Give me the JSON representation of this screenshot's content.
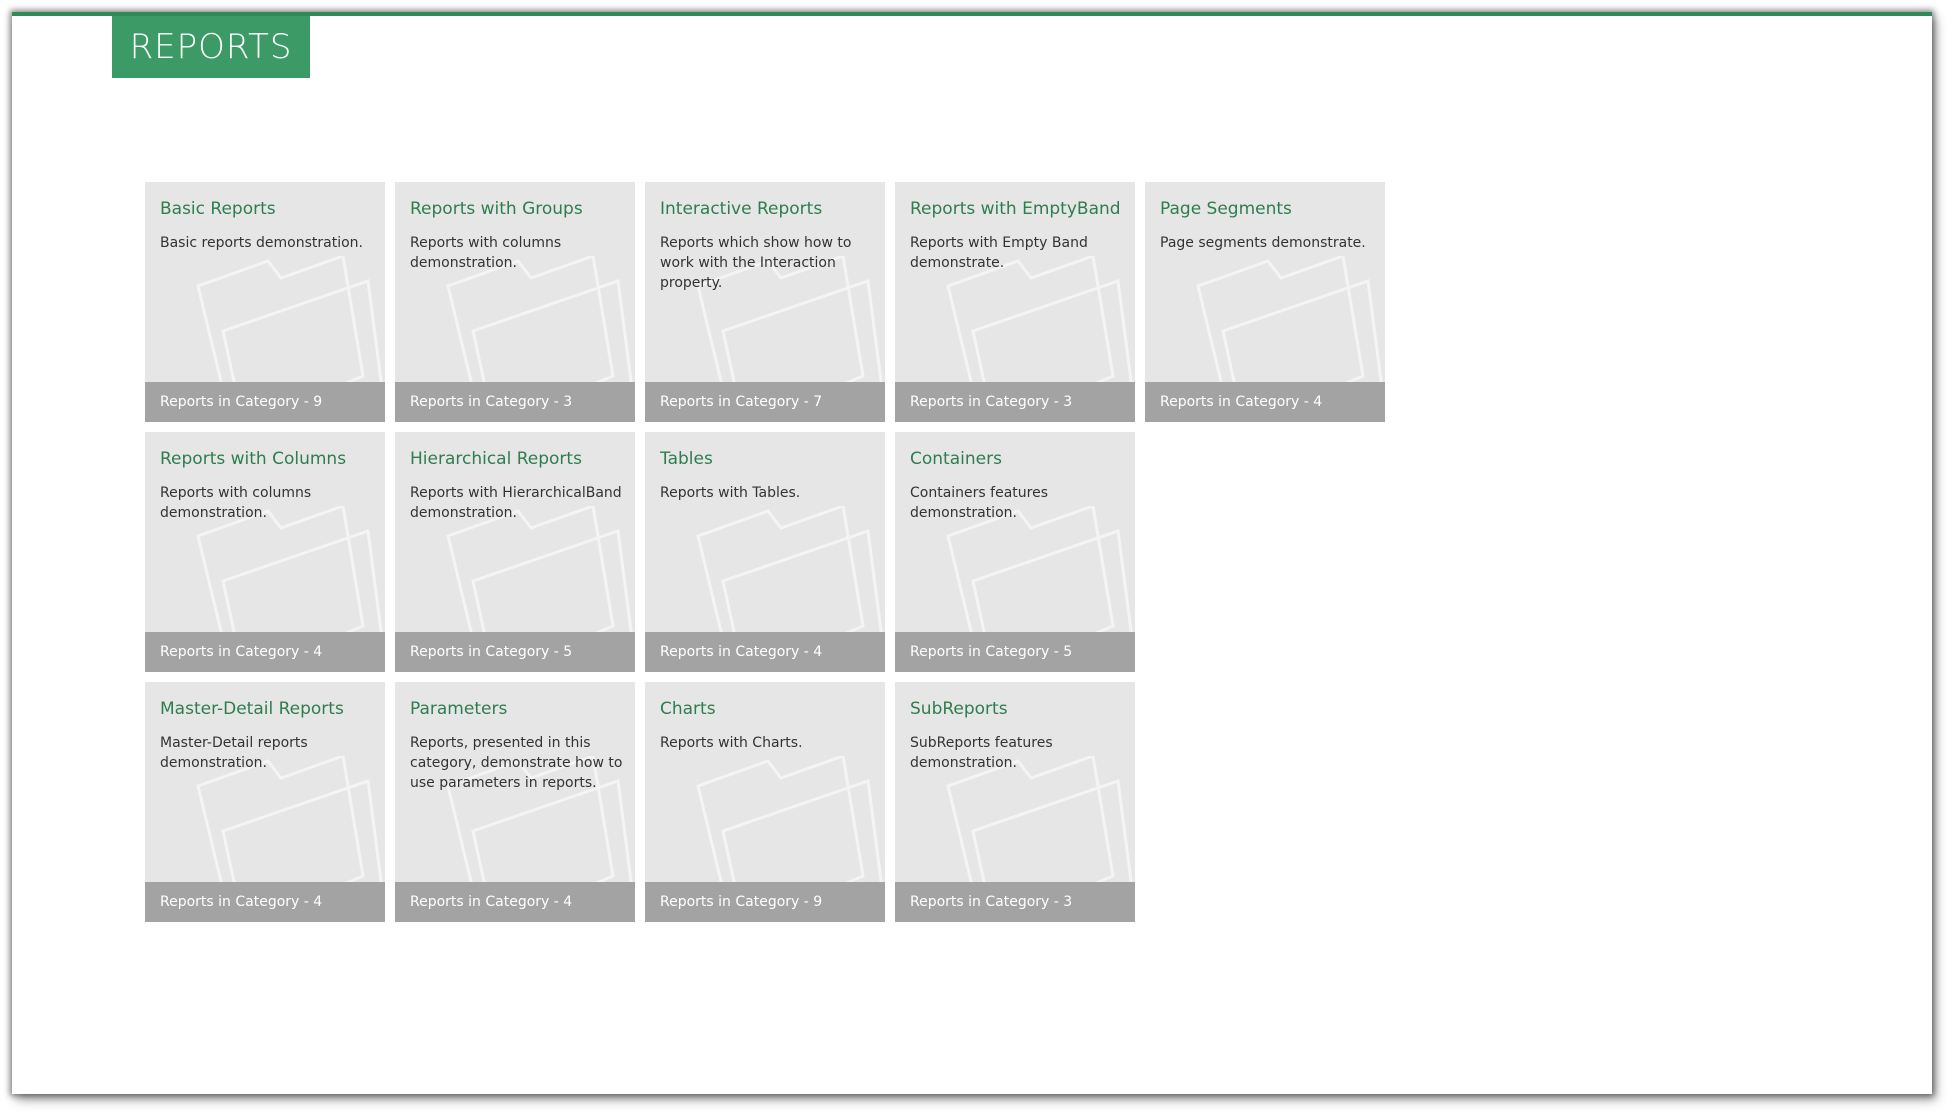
{
  "header": {
    "title": "REPORTS"
  },
  "colors": {
    "accent": "#3c9a66",
    "title_text": "#2f7d4f",
    "tile_bg": "#e6e6e6",
    "footer_bg": "#a3a3a3"
  },
  "tiles": [
    {
      "title": "Basic Reports",
      "description": "Basic reports demonstration.",
      "footer_label": "Reports in Category",
      "footer_sep": " - ",
      "count": "9",
      "icon": "folder-icon"
    },
    {
      "title": "Reports with Groups",
      "description": "Reports with columns demonstration.",
      "footer_label": "Reports in Category",
      "footer_sep": " - ",
      "count": "3",
      "icon": "folder-icon"
    },
    {
      "title": "Interactive Reports",
      "description": "Reports which show how to work with the Interaction property.",
      "footer_label": "Reports in Category",
      "footer_sep": " - ",
      "count": "7",
      "icon": "folder-icon"
    },
    {
      "title": "Reports with EmptyBand",
      "description": "Reports with Empty Band demonstrate.",
      "footer_label": "Reports in Category",
      "footer_sep": " - ",
      "count": "3",
      "icon": "folder-icon"
    },
    {
      "title": "Page Segments",
      "description": "Page segments demonstrate.",
      "footer_label": "Reports in Category",
      "footer_sep": " - ",
      "count": "4",
      "icon": "folder-icon"
    },
    {
      "title": "Reports with Columns",
      "description": "Reports with columns demonstration.",
      "footer_label": "Reports in Category",
      "footer_sep": " - ",
      "count": "4",
      "icon": "folder-icon"
    },
    {
      "title": "Hierarchical Reports",
      "description": "Reports with HierarchicalBand demonstration.",
      "footer_label": "Reports in Category",
      "footer_sep": " - ",
      "count": "5",
      "icon": "folder-icon"
    },
    {
      "title": "Tables",
      "description": "Reports with Tables.",
      "footer_label": "Reports in Category",
      "footer_sep": " - ",
      "count": "4",
      "icon": "folder-icon"
    },
    {
      "title": "Containers",
      "description": "Containers features demonstration.",
      "footer_label": "Reports in Category",
      "footer_sep": " - ",
      "count": "5",
      "icon": "folder-icon"
    },
    {
      "title": "Master-Detail Reports",
      "description": "Master-Detail reports demonstration.",
      "footer_label": "Reports in Category",
      "footer_sep": " - ",
      "count": "4",
      "icon": "folder-icon"
    },
    {
      "title": "Parameters",
      "description": "Reports, presented in this category, demonstrate how to use parameters in reports.",
      "footer_label": "Reports in Category",
      "footer_sep": " - ",
      "count": "4",
      "icon": "folder-icon"
    },
    {
      "title": "Charts",
      "description": "Reports with Charts.",
      "footer_label": "Reports in Category",
      "footer_sep": " - ",
      "count": "9",
      "icon": "folder-icon"
    },
    {
      "title": "SubReports",
      "description": "SubReports features demonstration.",
      "footer_label": "Reports in Category",
      "footer_sep": " - ",
      "count": "3",
      "icon": "folder-icon"
    }
  ]
}
